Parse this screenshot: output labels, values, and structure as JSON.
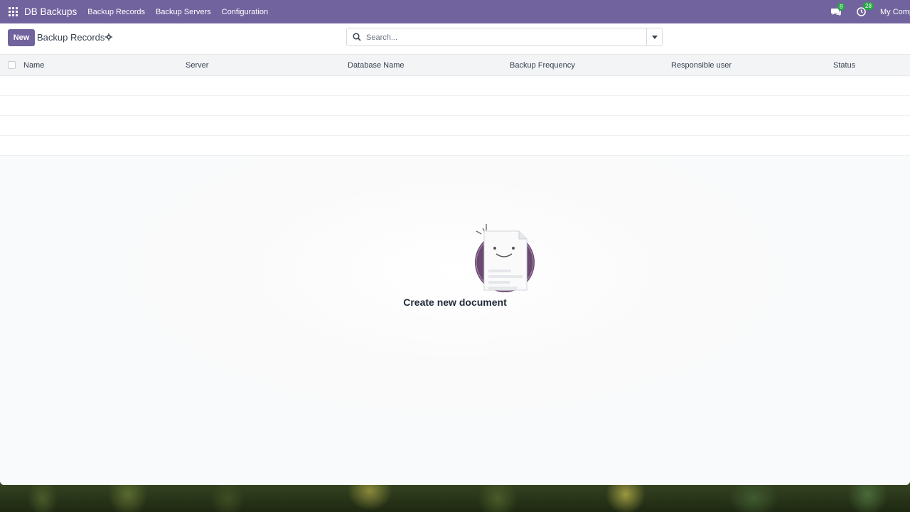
{
  "navbar": {
    "brand": "DB Backups",
    "menu": [
      {
        "label": "Backup Records"
      },
      {
        "label": "Backup Servers"
      },
      {
        "label": "Configuration"
      }
    ],
    "messages_badge": "8",
    "activities_badge": "28",
    "company": "My Comp",
    "accent_color": "#71639e"
  },
  "control_panel": {
    "new_label": "New",
    "breadcrumb": "Backup Records",
    "search_placeholder": "Search..."
  },
  "list": {
    "columns": [
      "Name",
      "Server",
      "Database Name",
      "Backup Frequency",
      "Responsible user",
      "Status"
    ]
  },
  "empty_state": {
    "title": "Create new document"
  }
}
